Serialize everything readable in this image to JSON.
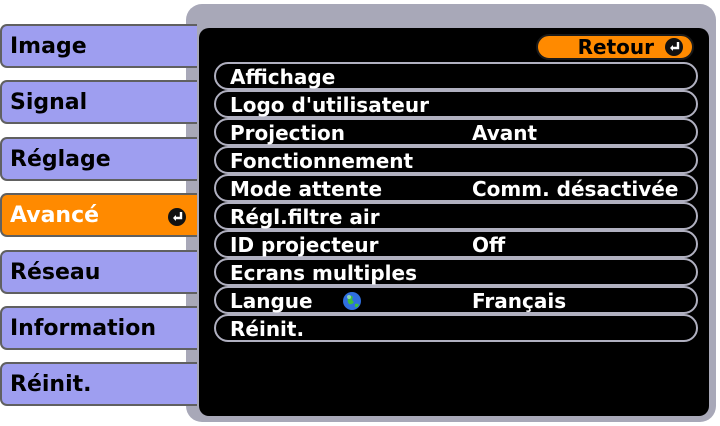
{
  "sidebar": {
    "items": [
      {
        "label": "Image"
      },
      {
        "label": "Signal"
      },
      {
        "label": "Réglage"
      },
      {
        "label": "Avancé"
      },
      {
        "label": "Réseau"
      },
      {
        "label": "Information"
      },
      {
        "label": "Réinit."
      }
    ],
    "active_index": 3,
    "active_color": "#ff8a00",
    "inactive_color": "#9e9ef0"
  },
  "back_button": {
    "label": "Retour",
    "icon": "enter-icon"
  },
  "menu": {
    "rows": [
      {
        "label": "Affichage",
        "value": ""
      },
      {
        "label": "Logo d'utilisateur",
        "value": ""
      },
      {
        "label": "Projection",
        "value": "Avant"
      },
      {
        "label": "Fonctionnement",
        "value": ""
      },
      {
        "label": "Mode attente",
        "value": "Comm. désactivée"
      },
      {
        "label": "Régl.filtre air",
        "value": ""
      },
      {
        "label": "ID projecteur",
        "value": "Off"
      },
      {
        "label": "Ecrans multiples",
        "value": ""
      },
      {
        "label": "Langue",
        "value": "Français",
        "icon": "globe-icon"
      },
      {
        "label": "Réinit.",
        "value": ""
      }
    ]
  }
}
